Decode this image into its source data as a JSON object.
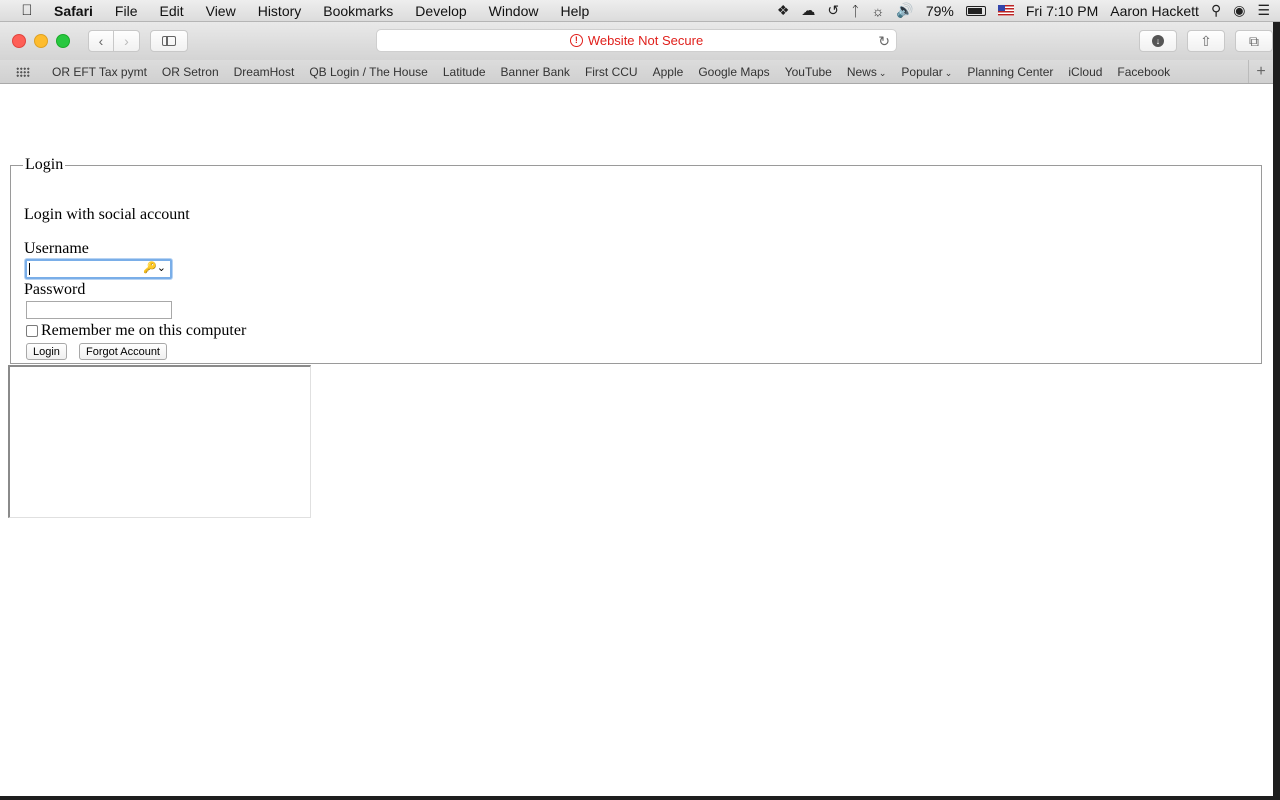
{
  "menubar": {
    "app": "Safari",
    "items": [
      "File",
      "Edit",
      "View",
      "History",
      "Bookmarks",
      "Develop",
      "Window",
      "Help"
    ],
    "battery": "79%",
    "clock": "Fri 7:10 PM",
    "user": "Aaron Hackett"
  },
  "toolbar": {
    "address_text": "Website Not Secure",
    "address_color": "#e0201c"
  },
  "bookmarks": {
    "items": [
      "OR EFT Tax pymt",
      "OR Setron",
      "DreamHost",
      "QB Login / The House",
      "Latitude",
      "Banner Bank",
      "First CCU",
      "Apple",
      "Google Maps",
      "YouTube"
    ],
    "folders": [
      "News",
      "Popular"
    ],
    "items_after": [
      "Planning Center",
      "iCloud",
      "Facebook"
    ]
  },
  "login": {
    "legend": "Login",
    "social_text": "Login with social account",
    "username_label": "Username",
    "password_label": "Password",
    "remember_label": "Remember me on this computer",
    "login_button": "Login",
    "forgot_button": "Forgot Account"
  }
}
